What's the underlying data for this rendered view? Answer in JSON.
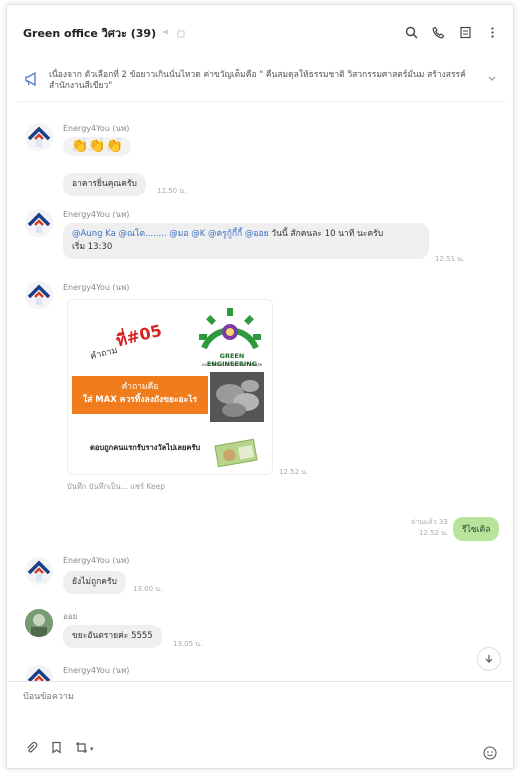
{
  "header": {
    "title": "Green office วิศวะ (39)",
    "icons": [
      "mute-icon",
      "note-icon",
      "search-icon",
      "phone-icon",
      "menu-icon",
      "more-icon"
    ]
  },
  "notice": {
    "text": "เนื่องจาก ตัวเลือกที่ 2 ข้อยาวเกินนั่นไหวด ค่าขวัญเต็มคือ \" คืนสมดุลให้ธรรมชาติ วิสวกรรมศาสตร์มั่นม สร้างสรรค์สำนักงานสีเขียว\""
  },
  "messages": [
    {
      "sender": "Energy4You (นพ)",
      "emoji": "👏👏👏"
    },
    {
      "text": "อาคารยิ่นคุณครับ",
      "time": "12.50 น."
    },
    {
      "sender": "Energy4You (นพ)",
      "text_mentions": "@Aung Ka @ณโต........ @มอ @K @ครูกู้กี้กี้ @ออย",
      "text_rest": " วันนี้ สักคนละ 10 นาที นะครับ",
      "text_line2": "เริ่ม 13:30",
      "time": "12.51 น."
    },
    {
      "sender": "Energy4You (นพ)",
      "image": {
        "question_label": "คำถาม",
        "question_num": "ที่#05",
        "logo_text": "GREEN ENGINEERING",
        "logo_sub": "คณะวิศวกรรมศาสตร์ มหาวิทยาลัย",
        "box_line1": "คำถามคือ",
        "box_line2": "ใส่ MAX ควรทิ้งลงถังขยะอะไร",
        "footer": "ตอบถูกคนแรกรับรางวัลไปเลยครับ"
      },
      "time": "12.52 น.",
      "actions": "บันทึก  บันทึกเป็น...  แชร์  Keep"
    },
    {
      "mine": true,
      "read": "อ่านแล้ว 33",
      "time": "12.52 น.",
      "text": "รีไซเคิล"
    },
    {
      "sender": "Energy4You (นพ)",
      "text": "ยังไม่ถูกครับ",
      "time": "13.00 น."
    },
    {
      "sender": "ออย",
      "text": "ขยะอันตรายค่ะ 5555",
      "time": "13.05 น."
    },
    {
      "sender": "Energy4You (นพ)"
    }
  ],
  "composer": {
    "placeholder": "ป้อนข้อความ",
    "tools": [
      "paperclip-icon",
      "save-icon",
      "crop-icon",
      "emoji-icon"
    ]
  }
}
